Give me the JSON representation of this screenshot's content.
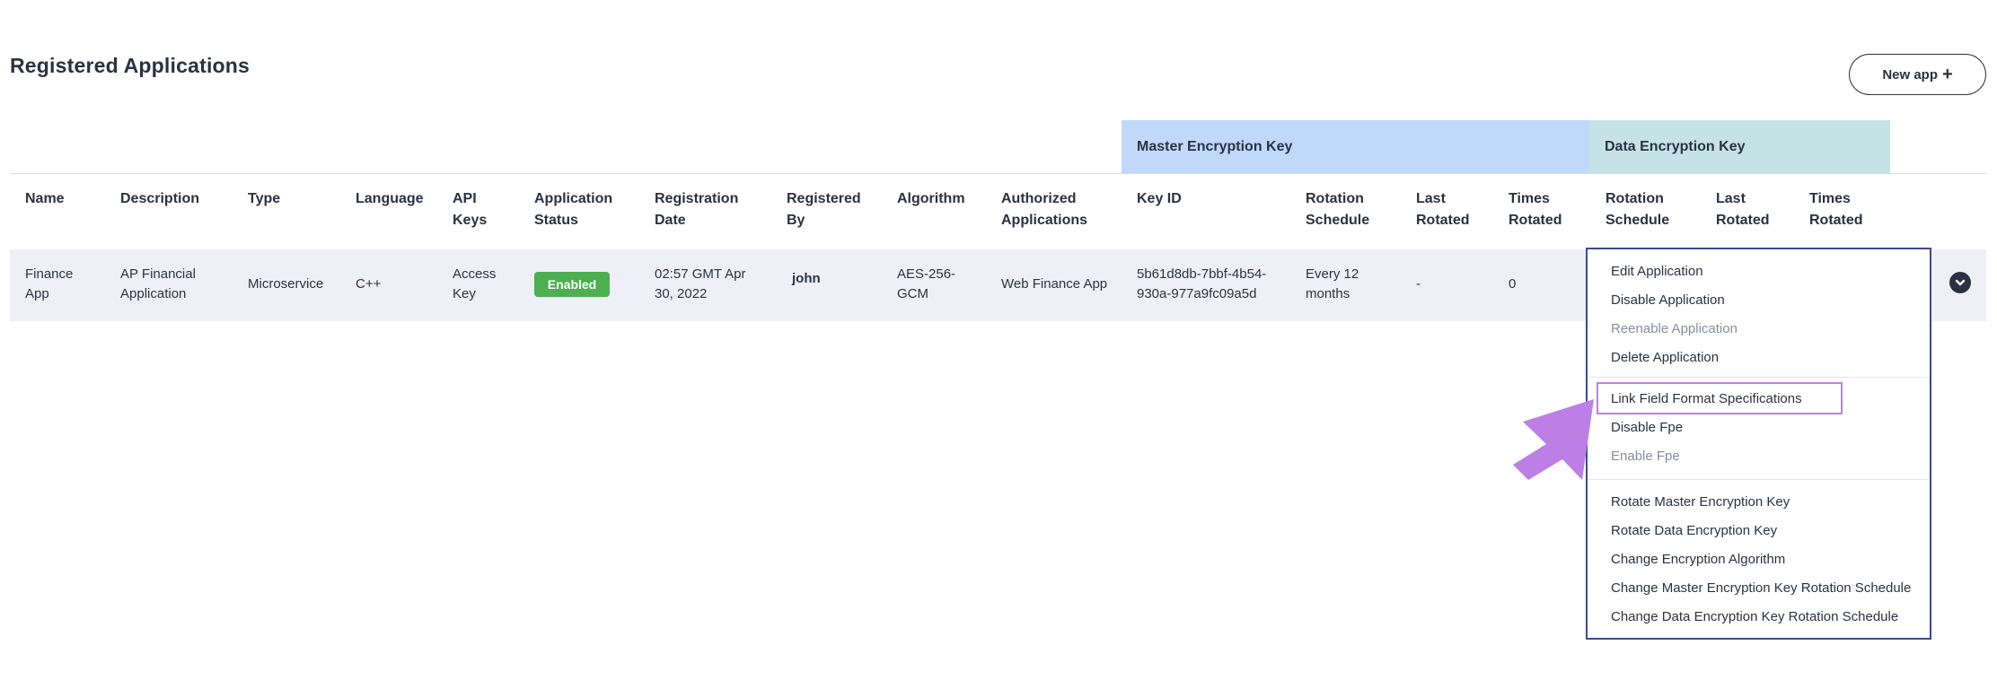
{
  "page": {
    "title": "Registered Applications"
  },
  "toolbar": {
    "new_app_label": "New app",
    "new_app_icon": "plus-icon"
  },
  "groups": {
    "master": "Master Encryption Key",
    "data": "Data Encryption Key"
  },
  "columns": [
    {
      "line1": "Name",
      "line2": ""
    },
    {
      "line1": "Description",
      "line2": ""
    },
    {
      "line1": "Type",
      "line2": ""
    },
    {
      "line1": "Language",
      "line2": ""
    },
    {
      "line1": "API",
      "line2": "Keys"
    },
    {
      "line1": "Application",
      "line2": "Status"
    },
    {
      "line1": "Registration",
      "line2": "Date"
    },
    {
      "line1": "Registered",
      "line2": "By"
    },
    {
      "line1": "Algorithm",
      "line2": ""
    },
    {
      "line1": "Authorized",
      "line2": "Applications"
    },
    {
      "line1": "Key ID",
      "line2": ""
    },
    {
      "line1": "Rotation",
      "line2": "Schedule"
    },
    {
      "line1": "Last",
      "line2": "Rotated"
    },
    {
      "line1": "Times",
      "line2": "Rotated"
    },
    {
      "line1": "Rotation",
      "line2": "Schedule"
    },
    {
      "line1": "Last",
      "line2": "Rotated"
    },
    {
      "line1": "Times",
      "line2": "Rotated"
    }
  ],
  "row": {
    "name": [
      "Finance",
      "App"
    ],
    "description": [
      "AP Financial",
      "Application"
    ],
    "type": "Microservice",
    "language": "C++",
    "api_keys": [
      "Access",
      "Key"
    ],
    "status": "Enabled",
    "registration_date": [
      "02:57 GMT Apr",
      "30, 2022"
    ],
    "registered_by": "john",
    "algorithm": [
      "AES-256-",
      "GCM"
    ],
    "authorized_applications": "Web Finance App",
    "key_id": [
      "5b61d8db-7bbf-4b54-",
      "930a-977a9fc09a5d"
    ],
    "master_rotation_schedule": [
      "Every 12",
      "months"
    ],
    "master_last_rotated": "-",
    "master_times_rotated": "0"
  },
  "colors": {
    "status_enabled": "#4caf50",
    "highlight": "#c07de8",
    "arrow": "#bd7fe6",
    "master_header": "#c0d9fb",
    "data_header": "#c5e3e6"
  },
  "menu": {
    "items": [
      {
        "label": "Edit Application",
        "enabled": true
      },
      {
        "label": "Disable Application",
        "enabled": true
      },
      {
        "label": "Reenable Application",
        "enabled": false
      },
      {
        "label": "Delete Application",
        "enabled": true
      },
      {
        "label": "Link Field Format Specifications",
        "enabled": true,
        "highlighted": true
      },
      {
        "label": "Disable Fpe",
        "enabled": true
      },
      {
        "label": "Enable Fpe",
        "enabled": false
      },
      {
        "label": "Rotate Master Encryption Key",
        "enabled": true
      },
      {
        "label": "Rotate Data Encryption Key",
        "enabled": true
      },
      {
        "label": "Change Encryption Algorithm",
        "enabled": true
      },
      {
        "label": "Change Master Encryption Key Rotation Schedule",
        "enabled": true
      },
      {
        "label": "Change Data Encryption Key Rotation Schedule",
        "enabled": true
      }
    ]
  }
}
